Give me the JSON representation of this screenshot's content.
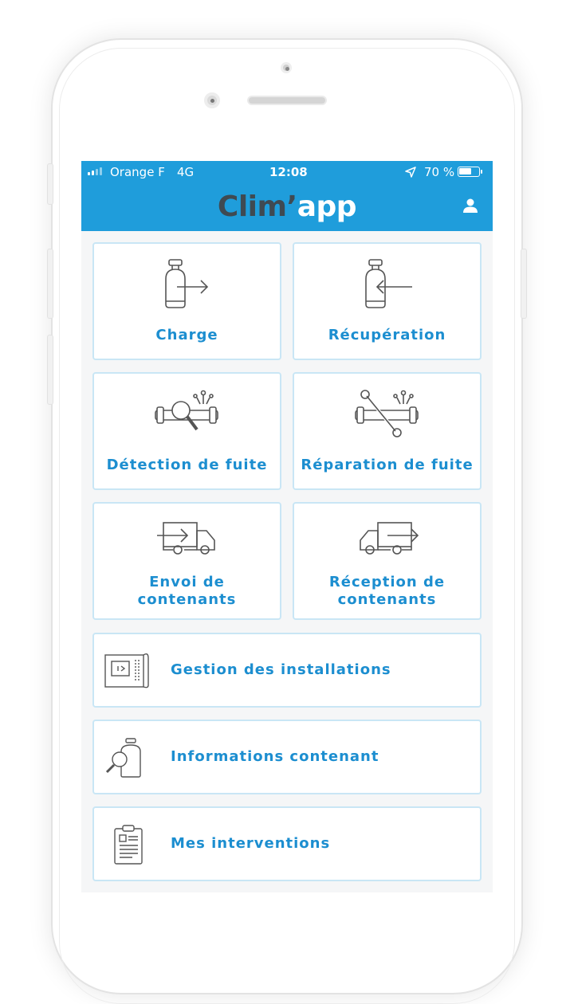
{
  "status_bar": {
    "carrier": "Orange F",
    "network": "4G",
    "time": "12:08",
    "battery": "70 %",
    "battery_level": 0.7
  },
  "app": {
    "logo_part1": "Clim’",
    "logo_part2": "app",
    "brand_color": "#1f9ddb",
    "label_color": "#1c8ed0",
    "icons": [
      "user-icon",
      "location-arrow-icon",
      "battery-icon",
      "signal-icon"
    ]
  },
  "menu": {
    "charge": "Charge",
    "recuperation": "Récupération",
    "detection": "Détection de fuite",
    "reparation": "Réparation de fuite",
    "envoi_line1": "Envoi de",
    "envoi_line2": "contenants",
    "reception_line1": "Réception de",
    "reception_line2": "contenants",
    "installations": "Gestion des installations",
    "informations": "Informations contenant",
    "interventions": "Mes interventions"
  }
}
